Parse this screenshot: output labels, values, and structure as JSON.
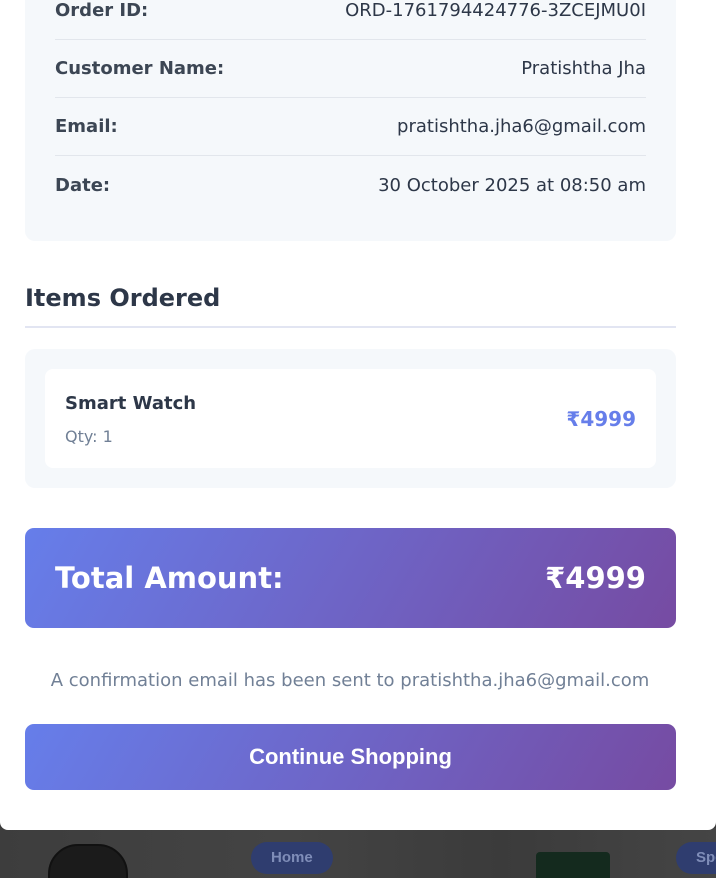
{
  "order_details": {
    "rows": [
      {
        "label": "Order ID:",
        "value": "ORD-1761794424776-3ZCEJMU0I"
      },
      {
        "label": "Customer Name:",
        "value": "Pratishtha Jha"
      },
      {
        "label": "Email:",
        "value": "pratishtha.jha6@gmail.com"
      },
      {
        "label": "Date:",
        "value": "30 October 2025 at 08:50 am"
      }
    ]
  },
  "items_section": {
    "title": "Items Ordered",
    "items": [
      {
        "name": "Smart Watch",
        "qty": "Qty: 1",
        "price": "₹4999"
      }
    ]
  },
  "total": {
    "label": "Total Amount:",
    "value": "₹4999"
  },
  "confirmation": "A confirmation email has been sent to pratishtha.jha6@gmail.com",
  "continue_button": "Continue Shopping",
  "background_page": {
    "nav_home": "Home",
    "nav_partial": "Spo"
  },
  "colors": {
    "accent_start": "#667eea",
    "accent_end": "#764ba2",
    "price": "#667eea"
  }
}
